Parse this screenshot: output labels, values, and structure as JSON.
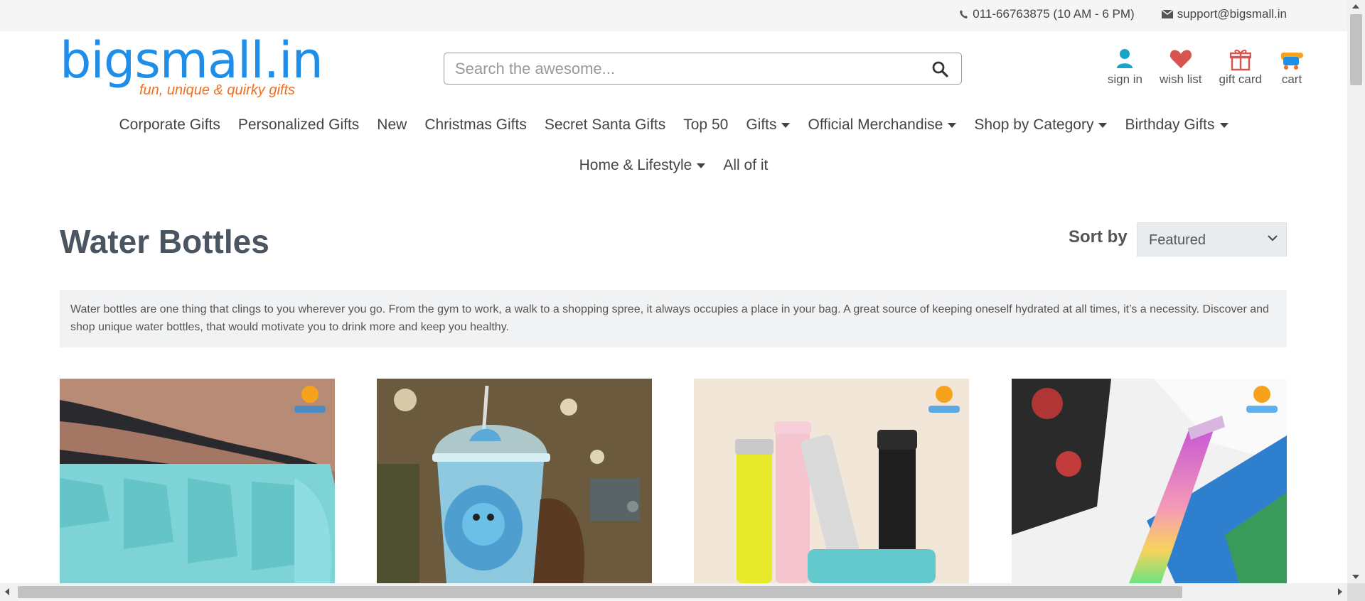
{
  "topbar": {
    "phone": "011-66763875 (10 AM - 6 PM)",
    "email": "support@bigsmall.in",
    "phone_icon": "phone-icon",
    "email_icon": "envelope-icon"
  },
  "logo": {
    "brand": "bigsmall.in",
    "tagline": "fun, unique & quirky gifts"
  },
  "search": {
    "placeholder": "Search the awesome...",
    "icon": "search-icon"
  },
  "header_links": [
    {
      "label": "sign in",
      "icon": "user-icon"
    },
    {
      "label": "wish list",
      "icon": "heart-icon"
    },
    {
      "label": "gift card",
      "icon": "gift-icon"
    },
    {
      "label": "cart",
      "icon": "cart-icon"
    }
  ],
  "nav": {
    "row1": [
      {
        "label": "Corporate Gifts"
      },
      {
        "label": "Personalized Gifts"
      },
      {
        "label": "New"
      },
      {
        "label": "Christmas Gifts"
      },
      {
        "label": "Secret Santa Gifts"
      },
      {
        "label": "Top 50"
      },
      {
        "label": "Gifts"
      },
      {
        "label": "Official Merchandise"
      },
      {
        "label": "Shop by Category"
      },
      {
        "label": "Birthday Gifts"
      }
    ],
    "row2": [
      {
        "label": "Home & Lifestyle"
      },
      {
        "label": "All of it"
      }
    ]
  },
  "page": {
    "title": "Water Bottles",
    "sort_label": "Sort by",
    "sort_value": "Featured",
    "description": "Water bottles are one thing that clings to you wherever you go. From the gym to work, a walk to a shopping spree, it always occupies a place in your bag. A great source of keeping oneself hydrated at all times, it’s a necessity. Discover and shop unique water bottles, that would motivate you to drink more and keep you healthy."
  },
  "colors": {
    "brand_blue": "#1e8ee8",
    "brand_orange": "#f26f21",
    "user_icon": "#1aa3c8",
    "heart": "#d9534f",
    "gift": "#d9534f"
  }
}
